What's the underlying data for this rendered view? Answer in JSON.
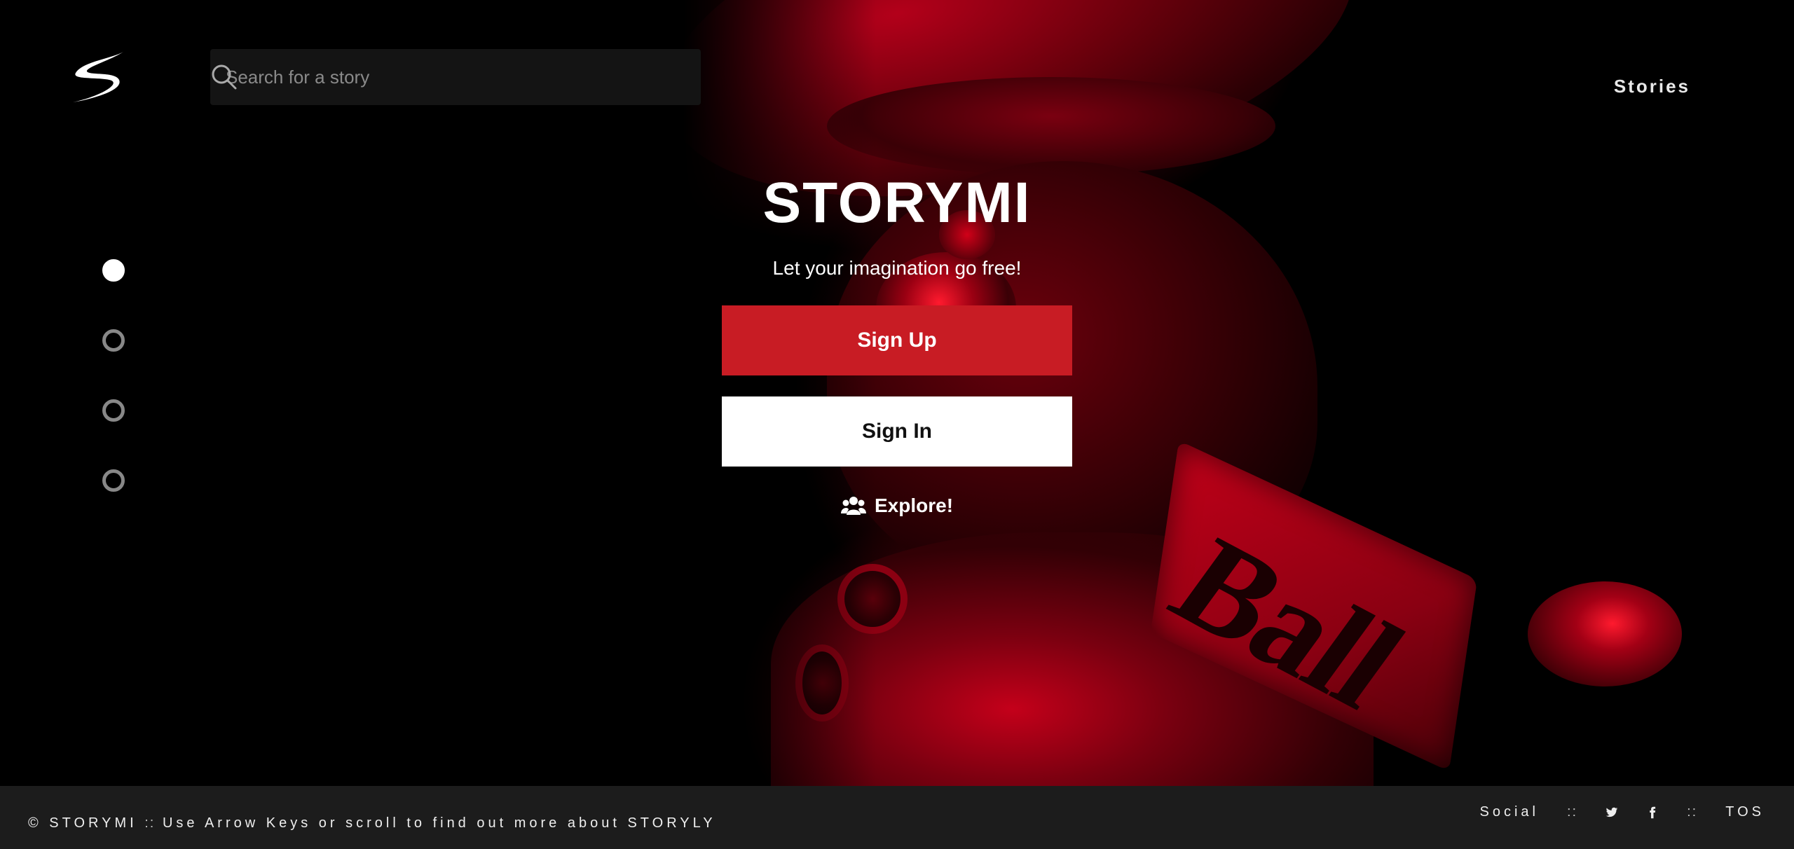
{
  "header": {
    "search": {
      "placeholder": "Search for a story"
    },
    "nav": {
      "stories_label": "Stories"
    }
  },
  "pager": {
    "count": 4,
    "active_index": 0
  },
  "hero": {
    "title": "STORYMI",
    "tagline": "Let your imagination go free!",
    "signup_label": "Sign Up",
    "signin_label": "Sign In",
    "explore_label": "Explore!",
    "background_sign_text": "Ball"
  },
  "footer": {
    "copyright": "© STORYMI",
    "separator": "::",
    "hint": "Use Arrow Keys or scroll to find out more about STORYLY",
    "social_label": "Social",
    "tos_label": "TOS",
    "social_icons": [
      "twitter-icon",
      "facebook-icon"
    ]
  },
  "colors": {
    "background": "#000000",
    "accent": "#c81c24",
    "footer_bg": "#1c1c1c",
    "search_bg": "#141414"
  }
}
